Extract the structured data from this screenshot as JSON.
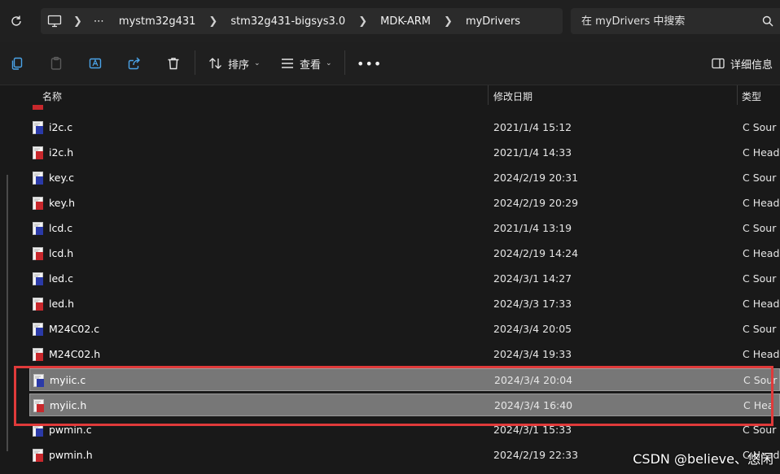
{
  "address_bar": {
    "breadcrumb": [
      "mystm32g431",
      "stm32g431-bigsys3.0",
      "MDK-ARM",
      "myDrivers"
    ],
    "search_placeholder": "在 myDrivers 中搜索"
  },
  "toolbar": {
    "sort_label": "排序",
    "view_label": "查看",
    "details_label": "详细信息"
  },
  "columns": {
    "name": "名称",
    "modified": "修改日期",
    "type": "类型"
  },
  "rows": [
    {
      "name": "i2c.c",
      "modified": "2021/1/4 15:12",
      "type": "C Sour",
      "kind": "c"
    },
    {
      "name": "i2c.h",
      "modified": "2021/1/4 14:33",
      "type": "C Head",
      "kind": "h"
    },
    {
      "name": "key.c",
      "modified": "2024/2/19 20:31",
      "type": "C Sour",
      "kind": "c"
    },
    {
      "name": "key.h",
      "modified": "2024/2/19 20:29",
      "type": "C Head",
      "kind": "h"
    },
    {
      "name": "lcd.c",
      "modified": "2021/1/4 13:19",
      "type": "C Sour",
      "kind": "c"
    },
    {
      "name": "lcd.h",
      "modified": "2024/2/19 14:24",
      "type": "C Head",
      "kind": "h"
    },
    {
      "name": "led.c",
      "modified": "2024/3/1 14:27",
      "type": "C Sour",
      "kind": "c"
    },
    {
      "name": "led.h",
      "modified": "2024/3/3 17:33",
      "type": "C Head",
      "kind": "h"
    },
    {
      "name": "M24C02.c",
      "modified": "2024/3/4 20:05",
      "type": "C Sour",
      "kind": "c"
    },
    {
      "name": "M24C02.h",
      "modified": "2024/3/4 19:33",
      "type": "C Head",
      "kind": "h"
    },
    {
      "name": "myiic.c",
      "modified": "2024/3/4 20:04",
      "type": "C Sour",
      "kind": "c",
      "selected": true
    },
    {
      "name": "myiic.h",
      "modified": "2024/3/4 16:40",
      "type": "C Hea",
      "kind": "h",
      "selected": true
    },
    {
      "name": "pwmin.c",
      "modified": "2024/3/1 15:33",
      "type": "C Sour",
      "kind": "c"
    },
    {
      "name": "pwmin.h",
      "modified": "2024/2/19 22:33",
      "type": "C Head",
      "kind": "h"
    }
  ],
  "watermark": "CSDN @believe、悠闲",
  "colors": {
    "background": "#191919",
    "selected_row": "#777777",
    "highlight_box": "#e03a3a",
    "c_icon": "#2b3aa8",
    "h_icon": "#c8282c"
  }
}
